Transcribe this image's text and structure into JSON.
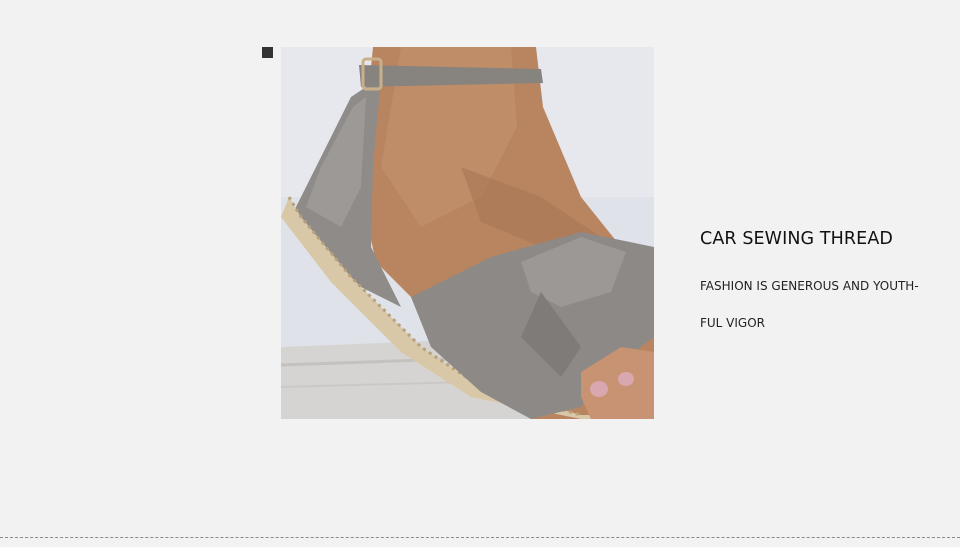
{
  "feature": {
    "title": "CAR SEWING THREAD",
    "description_lines": [
      "FASHION IS GENEROUS AND YOUTH-",
      "FUL VIGOR"
    ]
  },
  "photo": {
    "subject": "sandal-on-foot-photo"
  },
  "colors": {
    "background": "#f2f2f2",
    "bullet": "#333333",
    "suede": "#8f8b88",
    "divider": "#8a8a8a"
  }
}
